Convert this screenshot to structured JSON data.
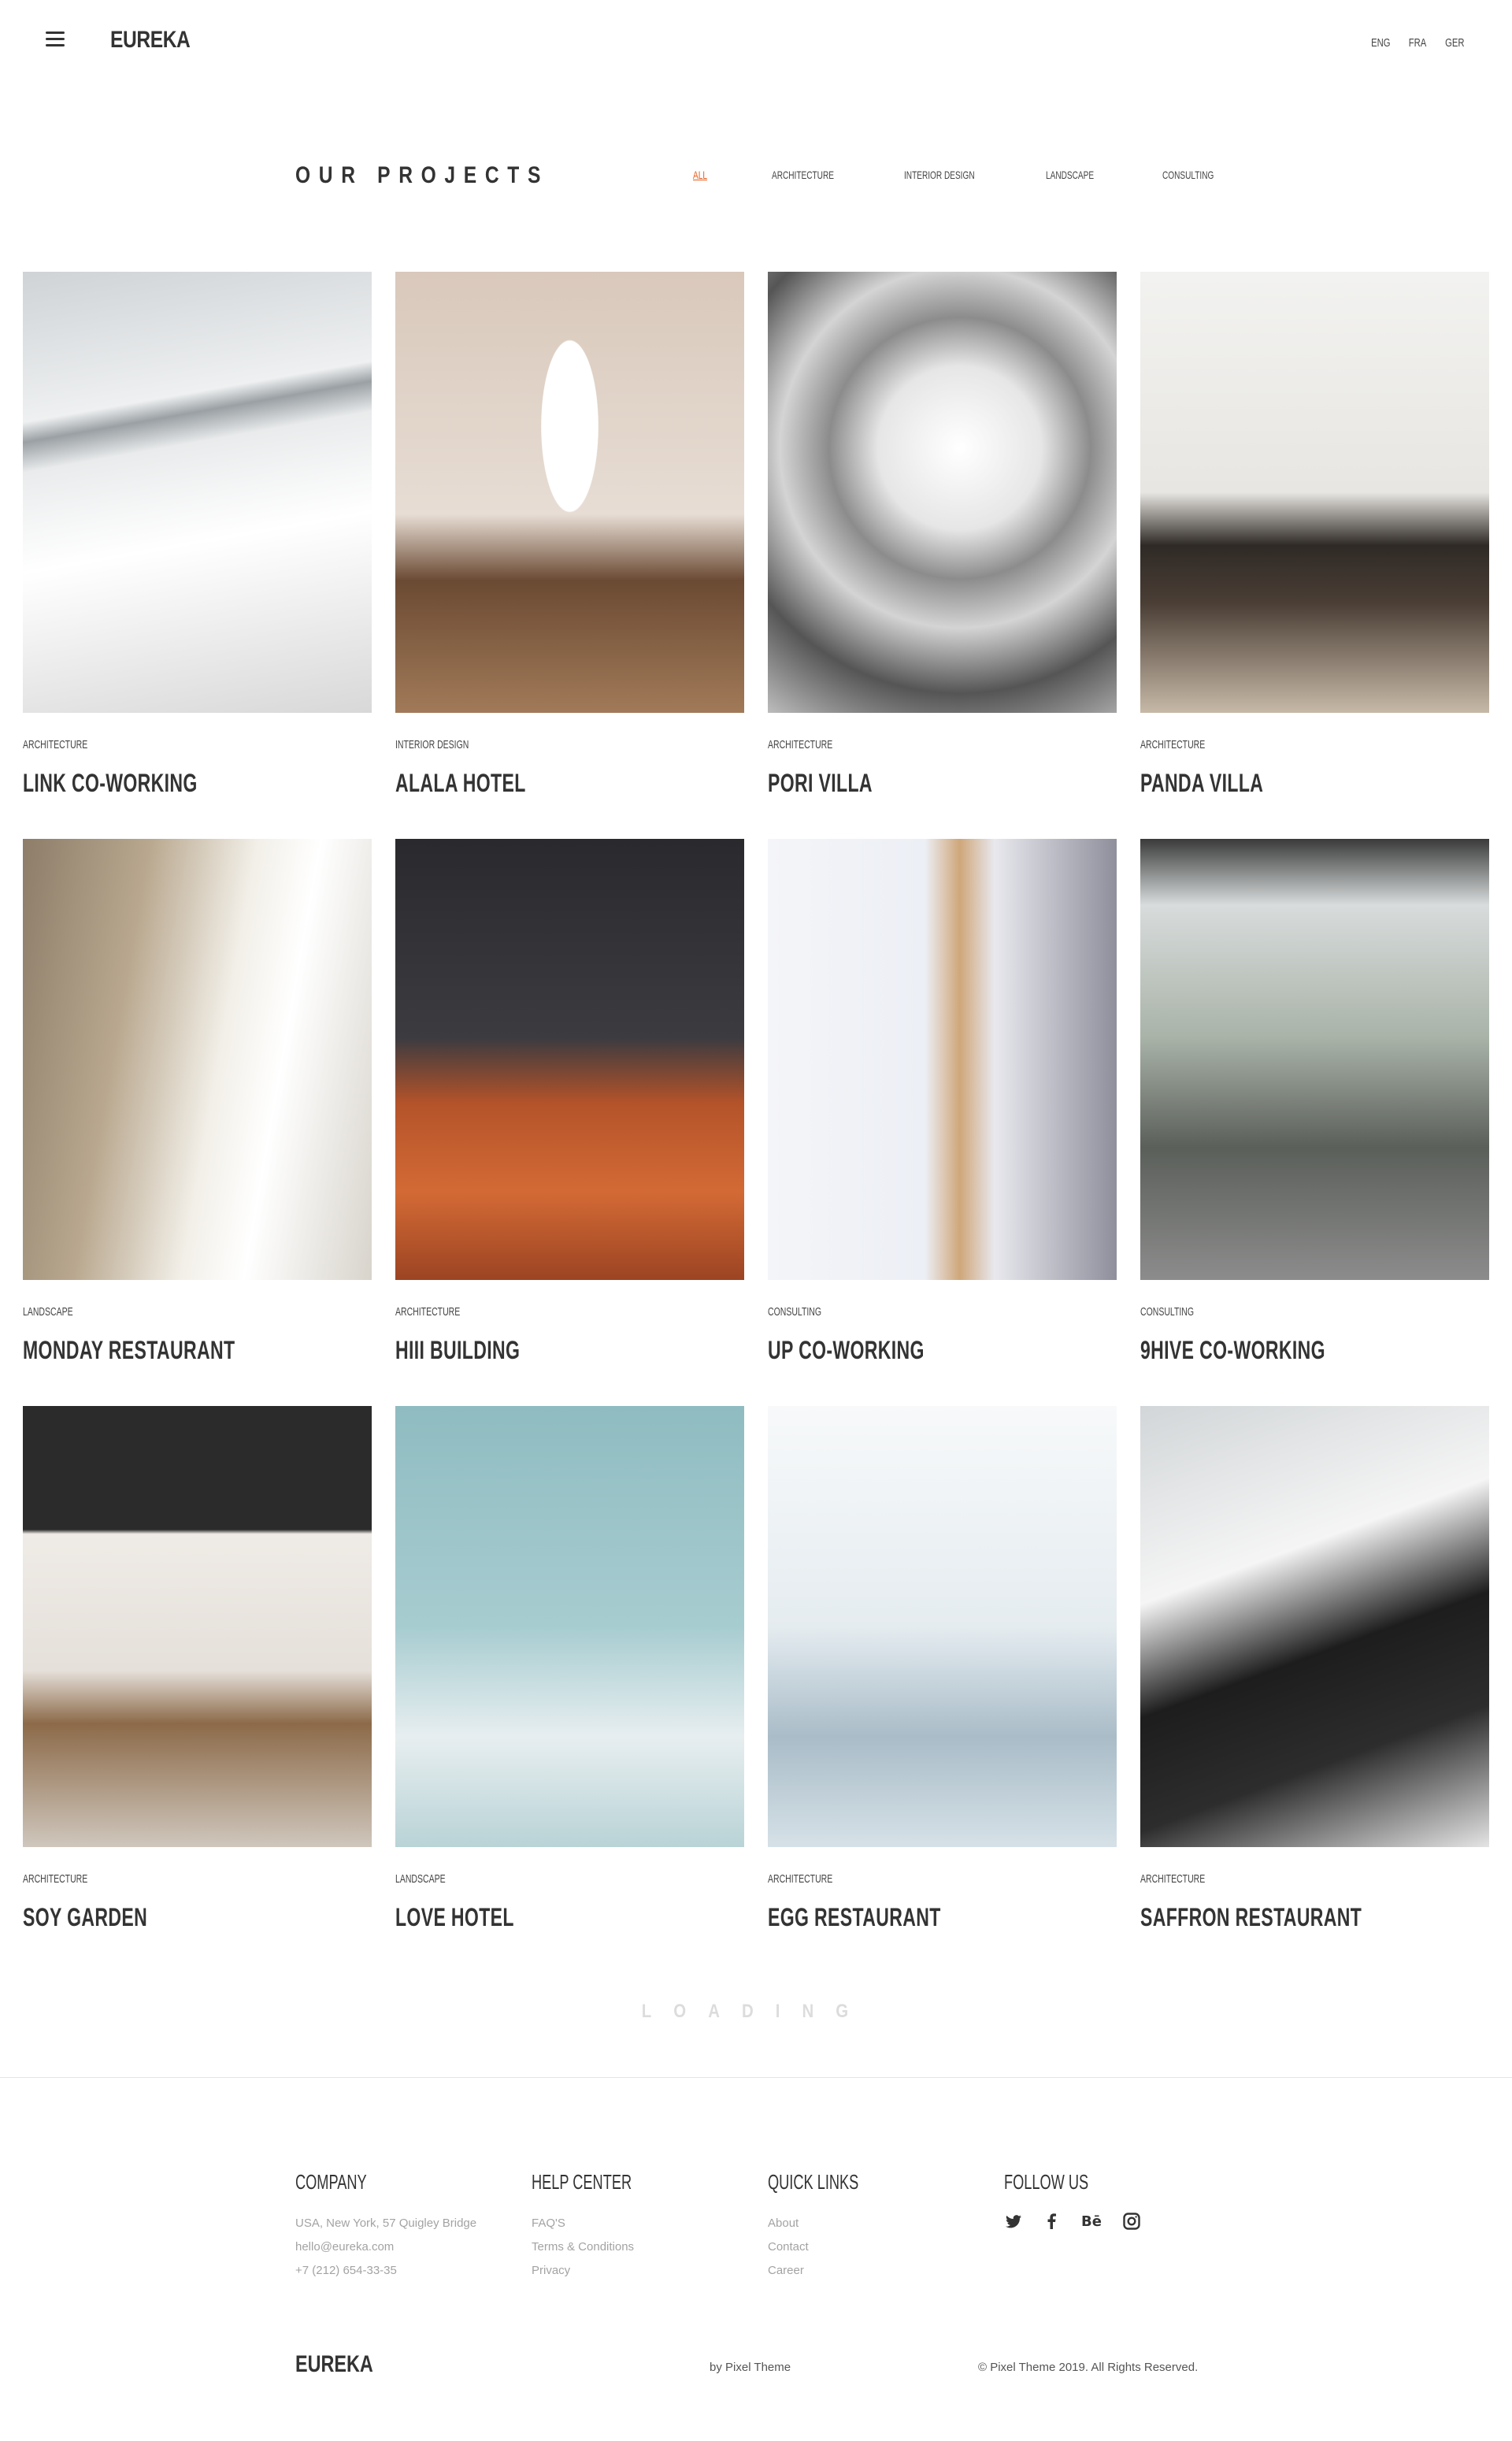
{
  "header": {
    "logo": "EUREKA",
    "languages": [
      "ENG",
      "FRA",
      "GER"
    ]
  },
  "projects": {
    "title": "OUR PROJECTS",
    "filters": [
      {
        "label": "ALL",
        "active": true
      },
      {
        "label": "ARCHITECTURE",
        "active": false
      },
      {
        "label": "INTERIOR DESIGN",
        "active": false
      },
      {
        "label": "LANDSCAPE",
        "active": false
      },
      {
        "label": "CONSULTING",
        "active": false
      }
    ],
    "accent_color": "#e8591a",
    "items": [
      {
        "category": "ARCHITECTURE",
        "name": "LINK CO-WORKING",
        "image": "skylight-interior"
      },
      {
        "category": "INTERIOR DESIGN",
        "name": "ALALA HOTEL",
        "image": "arched-window-cafe"
      },
      {
        "category": "ARCHITECTURE",
        "name": "PORI VILLA",
        "image": "spiral-staircase"
      },
      {
        "category": "ARCHITECTURE",
        "name": "PANDA VILLA",
        "image": "pendant-lamp-room"
      },
      {
        "category": "LANDSCAPE",
        "name": "MONDAY RESTAURANT",
        "image": "brick-dining-room"
      },
      {
        "category": "ARCHITECTURE",
        "name": "HIII BUILDING",
        "image": "orange-table-pendants"
      },
      {
        "category": "CONSULTING",
        "name": "UP CO-WORKING",
        "image": "bedside-table-lamp"
      },
      {
        "category": "CONSULTING",
        "name": "9HIVE CO-WORKING",
        "image": "glass-cafe"
      },
      {
        "category": "ARCHITECTURE",
        "name": "SOY GARDEN",
        "image": "desk-lamp-wood"
      },
      {
        "category": "LANDSCAPE",
        "name": "LOVE HOTEL",
        "image": "facade-sky"
      },
      {
        "category": "ARCHITECTURE",
        "name": "EGG RESTAURANT",
        "image": "symmetric-hall"
      },
      {
        "category": "ARCHITECTURE",
        "name": "SAFFRON RESTAURANT",
        "image": "white-escalator"
      }
    ]
  },
  "loading": "LOADING",
  "footer": {
    "columns": [
      {
        "title": "COMPANY",
        "links": [
          "USA, New York, 57 Quigley Bridge",
          "hello@eureka.com",
          "+7 (212) 654-33-35"
        ]
      },
      {
        "title": "HELP CENTER",
        "links": [
          "FAQ'S",
          "Terms & Conditions",
          "Privacy"
        ]
      },
      {
        "title": "QUICK LINKS",
        "links": [
          "About",
          "Contact",
          "Career"
        ]
      },
      {
        "title": "FOLLOW US",
        "social": [
          "twitter-icon",
          "facebook-icon",
          "behance-icon",
          "instagram-icon"
        ]
      }
    ],
    "logo": "EUREKA",
    "byline": "by Pixel Theme",
    "copyright": "© Pixel Theme 2019. All Rights Reserved."
  }
}
